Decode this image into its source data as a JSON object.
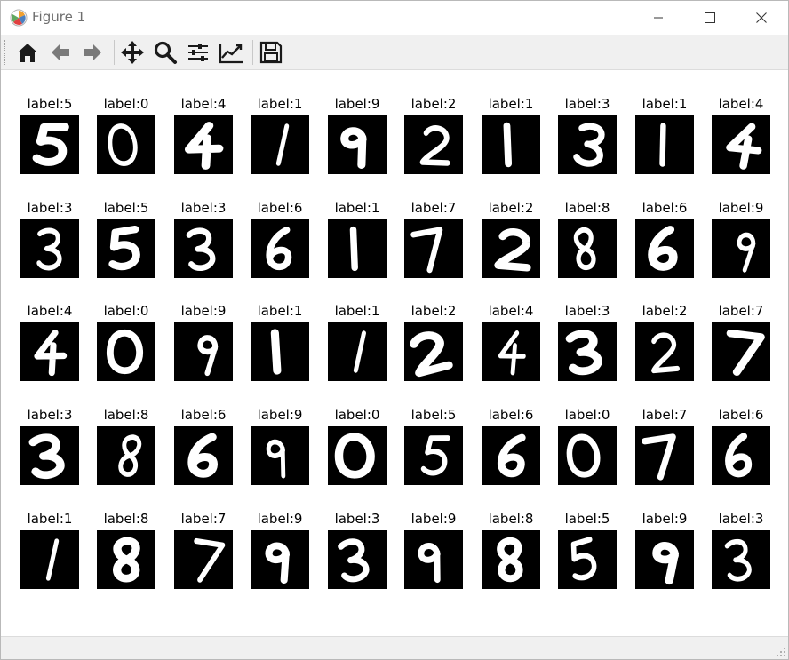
{
  "window": {
    "title": "Figure 1"
  },
  "toolbar": {
    "buttons": [
      {
        "name": "home-icon",
        "tooltip": "Home"
      },
      {
        "name": "back-arrow-icon",
        "tooltip": "Back"
      },
      {
        "name": "forward-arrow-icon",
        "tooltip": "Forward"
      },
      {
        "name": "pan-icon",
        "tooltip": "Pan"
      },
      {
        "name": "zoom-icon",
        "tooltip": "Zoom"
      },
      {
        "name": "subplots-icon",
        "tooltip": "Subplots"
      },
      {
        "name": "customize-icon",
        "tooltip": "Customize"
      },
      {
        "name": "save-icon",
        "tooltip": "Save"
      }
    ]
  },
  "grid": {
    "labels": [
      [
        "label:5",
        "label:0",
        "label:4",
        "label:1",
        "label:9",
        "label:2",
        "label:1",
        "label:3",
        "label:1",
        "label:4"
      ],
      [
        "label:3",
        "label:5",
        "label:3",
        "label:6",
        "label:1",
        "label:7",
        "label:2",
        "label:8",
        "label:6",
        "label:9"
      ],
      [
        "label:4",
        "label:0",
        "label:9",
        "label:1",
        "label:1",
        "label:2",
        "label:4",
        "label:3",
        "label:2",
        "label:7"
      ],
      [
        "label:3",
        "label:8",
        "label:6",
        "label:9",
        "label:0",
        "label:5",
        "label:6",
        "label:0",
        "label:7",
        "label:6"
      ],
      [
        "label:1",
        "label:8",
        "label:7",
        "label:9",
        "label:3",
        "label:9",
        "label:8",
        "label:5",
        "label:9",
        "label:3"
      ]
    ],
    "digits": [
      [
        5,
        0,
        4,
        1,
        9,
        2,
        1,
        3,
        1,
        4
      ],
      [
        3,
        5,
        3,
        6,
        1,
        7,
        2,
        8,
        6,
        9
      ],
      [
        4,
        0,
        9,
        1,
        1,
        2,
        4,
        3,
        2,
        7
      ],
      [
        3,
        8,
        6,
        9,
        0,
        5,
        6,
        0,
        7,
        6
      ],
      [
        1,
        8,
        7,
        9,
        3,
        9,
        8,
        5,
        9,
        3
      ]
    ]
  }
}
